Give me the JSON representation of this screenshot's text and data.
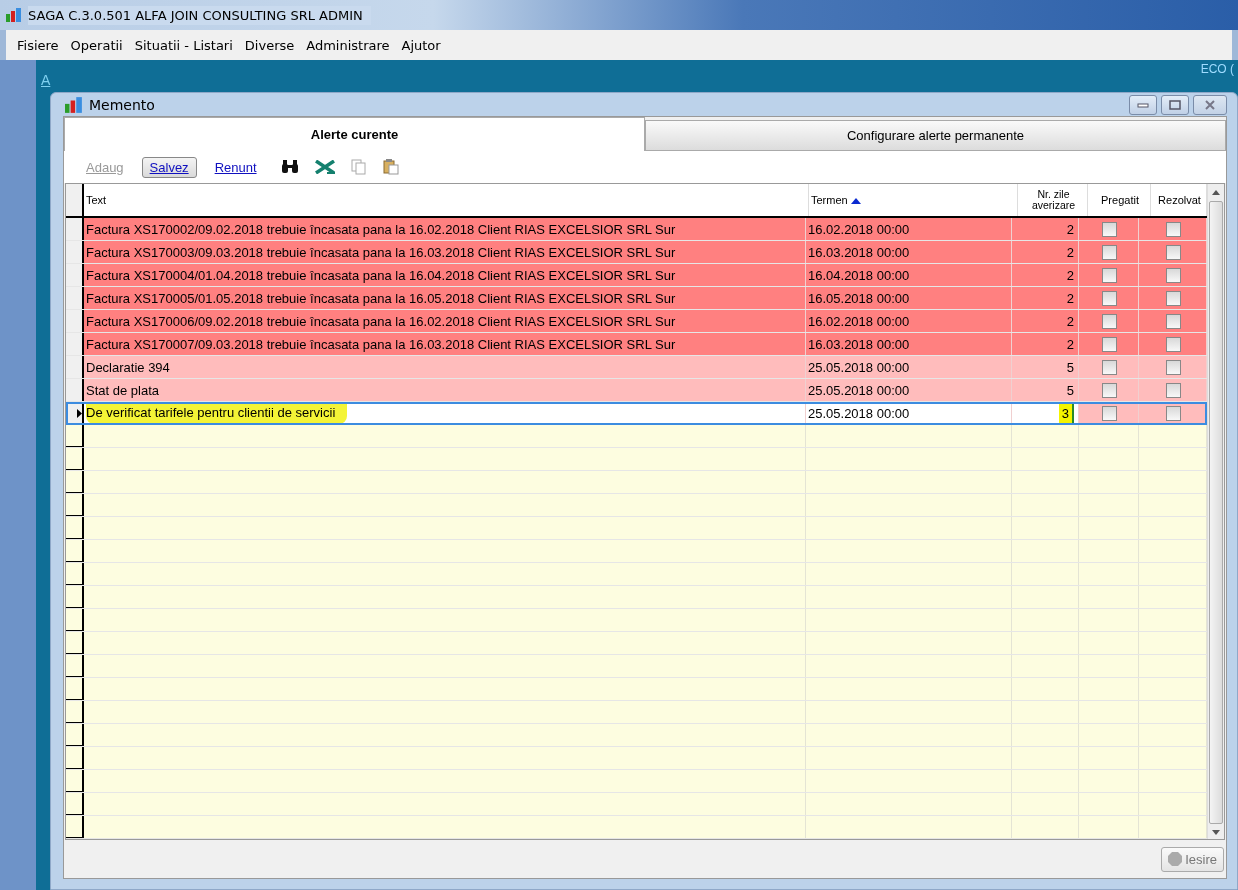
{
  "app_title": "SAGA C.3.0.501  ALFA JOIN CONSULTING SRL  ADMIN",
  "menu": [
    "Fisiere",
    "Operatii",
    "Situatii - Listari",
    "Diverse",
    "Administrare",
    "Ajutor"
  ],
  "background_texts": [
    "A",
    "ECO ("
  ],
  "window": {
    "title": "Memento"
  },
  "tabs": [
    {
      "label": "Alerte curente",
      "selected": true
    },
    {
      "label": "Configurare alerte permanente",
      "selected": false
    }
  ],
  "toolbar": [
    {
      "label": "Adaug",
      "disabled": true,
      "pressed": false
    },
    {
      "label": "Salvez",
      "disabled": false,
      "pressed": true
    },
    {
      "label": "Renunt",
      "disabled": false,
      "pressed": false
    }
  ],
  "table": {
    "columns": [
      {
        "label": "Text",
        "sorted": false
      },
      {
        "label": "Termen",
        "sorted": true
      },
      {
        "label": "Nr. zile averizare",
        "sorted": false
      },
      {
        "label": "Pregatit",
        "sorted": false
      },
      {
        "label": "Rezolvat",
        "sorted": false
      }
    ],
    "rows": [
      {
        "text": "Factura XS170002/09.02.2018 trebuie încasata pana la 16.02.2018 Client RIAS EXCELSIOR SRL Sur",
        "termen": "16.02.2018 00:00",
        "days": "2",
        "pregatit": false,
        "rezolvat": false,
        "color": "#ff8080",
        "selected": false
      },
      {
        "text": "Factura XS170003/09.03.2018 trebuie încasata pana la 16.03.2018 Client RIAS EXCELSIOR SRL Sur",
        "termen": "16.03.2018 00:00",
        "days": "2",
        "pregatit": false,
        "rezolvat": false,
        "color": "#ff8080",
        "selected": false
      },
      {
        "text": "Factura XS170004/01.04.2018 trebuie încasata pana la 16.04.2018 Client RIAS EXCELSIOR SRL Sur",
        "termen": "16.04.2018 00:00",
        "days": "2",
        "pregatit": false,
        "rezolvat": false,
        "color": "#ff8080",
        "selected": false
      },
      {
        "text": "Factura XS170005/01.05.2018 trebuie încasata pana la 16.05.2018 Client RIAS EXCELSIOR SRL Sur",
        "termen": "16.05.2018 00:00",
        "days": "2",
        "pregatit": false,
        "rezolvat": false,
        "color": "#ff8080",
        "selected": false
      },
      {
        "text": "Factura XS170006/09.02.2018 trebuie încasata pana la 16.02.2018 Client RIAS EXCELSIOR SRL Sur",
        "termen": "16.02.2018 00:00",
        "days": "2",
        "pregatit": false,
        "rezolvat": false,
        "color": "#ff8080",
        "selected": false
      },
      {
        "text": "Factura XS170007/09.03.2018 trebuie încasata pana la 16.03.2018 Client RIAS EXCELSIOR SRL Sur",
        "termen": "16.03.2018 00:00",
        "days": "2",
        "pregatit": false,
        "rezolvat": false,
        "color": "#ff8080",
        "selected": false
      },
      {
        "text": "Declaratie 394",
        "termen": "25.05.2018 00:00",
        "days": "5",
        "pregatit": false,
        "rezolvat": false,
        "color": "#ffbcbc",
        "selected": false
      },
      {
        "text": "Stat de plata",
        "termen": "25.05.2018 00:00",
        "days": "5",
        "pregatit": false,
        "rezolvat": false,
        "color": "#ffbcbc",
        "selected": false
      },
      {
        "text": "De verificat tarifele pentru clientii de servicii",
        "termen": "25.05.2018 00:00",
        "days": "3",
        "pregatit": false,
        "rezolvat": false,
        "color": "#ffbcbc",
        "selected": true
      }
    ]
  },
  "exit_button": "Iesire"
}
